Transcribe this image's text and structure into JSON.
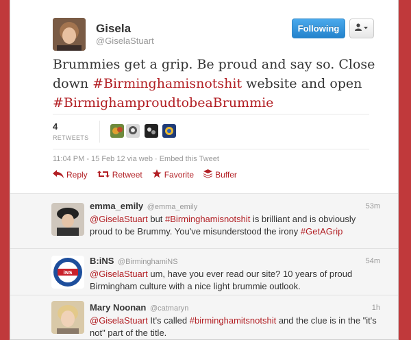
{
  "tweet": {
    "name": "Gisela",
    "handle": "@GiselaStuart",
    "follow_label": "Following",
    "text_1": "Brummies get a grip. Be proud and say so. Close down ",
    "hashtag_1": "#Birminghamisnotshit",
    "text_2": " website and open ",
    "hashtag_2": "#BirmighamproudtobeaBrummie",
    "retweets_count": "4",
    "retweets_label": "RETWEETS",
    "meta": "11:04 PM - 15 Feb 12 via web · Embed this Tweet",
    "actions": {
      "reply": "Reply",
      "retweet": "Retweet",
      "favorite": "Favorite",
      "buffer": "Buffer"
    }
  },
  "replies": [
    {
      "name": "emma_emily",
      "handle": "@emma_emily",
      "time": "53m",
      "mention": "@GiselaStuart",
      "text_a": " but ",
      "tag": "#Birminghamisnotshit",
      "text_b": " is brilliant and is obviously proud to be Brummy. You've misunderstood the irony ",
      "tag2": "#GetAGrip"
    },
    {
      "name": "B:iNS",
      "handle": "@BirminghamiNS",
      "time": "54m",
      "mention": "@GiselaStuart",
      "text_a": " um, have you ever read our site? 10 years of proud Birmingham culture with a nice light brummie outlook."
    },
    {
      "name": "Mary Noonan",
      "handle": "@catmaryn",
      "time": "1h",
      "mention": "@GiselaStuart",
      "text_a": " It's called ",
      "tag": "#birminghamitsnotshit",
      "text_b": " and the clue is in the \"it's not\" part of the title."
    }
  ],
  "colors": {
    "background": "#c0393b",
    "accent": "#b21f24",
    "follow_button": "#2483cc"
  }
}
